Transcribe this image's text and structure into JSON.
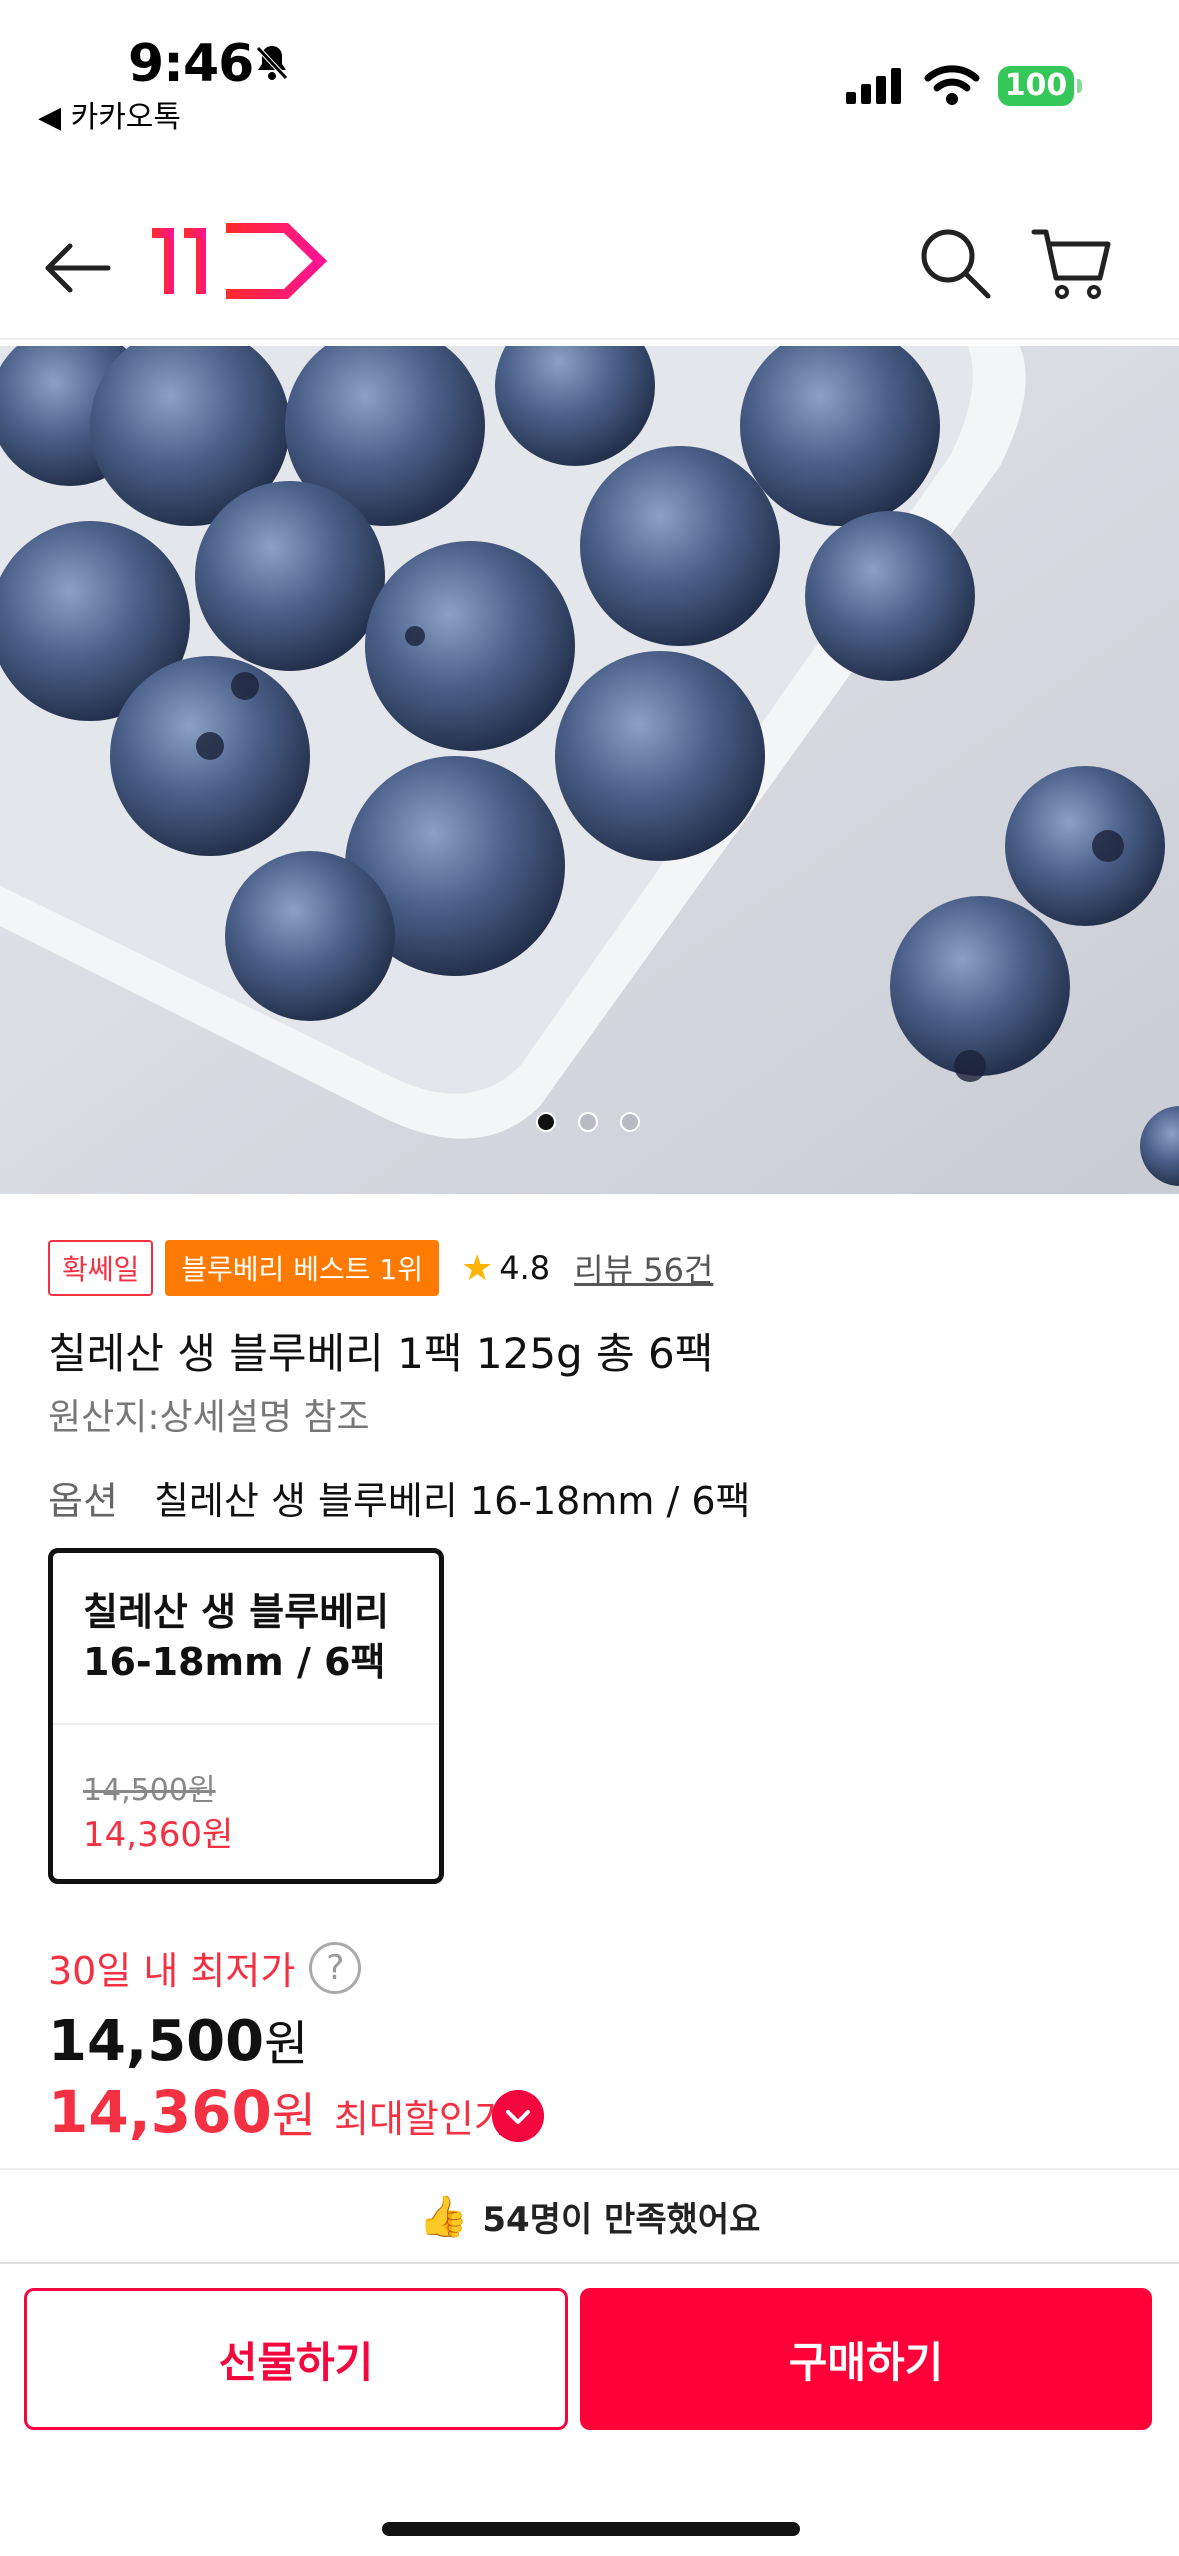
{
  "status": {
    "time": "9:46",
    "back_app": "◀ 카카오톡",
    "battery": "100"
  },
  "header": {
    "logo_text": "11",
    "icons": [
      "back-arrow-icon",
      "search-icon",
      "cart-icon"
    ]
  },
  "gallery": {
    "dot_count": 3,
    "active_index": 0
  },
  "product": {
    "badge_delivery": "확쎄일",
    "badge_best": "블루베리 베스트 1위",
    "rating": "4.8",
    "reviews": "리뷰 56건",
    "title": "칠레산 생 블루베리 1팩 125g 총 6팩",
    "origin": "원산지:상세설명 참조",
    "option_label": "옵션",
    "option_value": "칠레산 생 블루베리 16-18mm / 6팩"
  },
  "option_card": {
    "name": "칠레산 생 블루베리 16-18mm / 6팩",
    "original_price": "14,500원",
    "sale_price": "14,360원"
  },
  "pricing": {
    "lowest_label": "30일 내 최저가",
    "help": "?",
    "price": "14,500",
    "price_unit": "원",
    "sale_price": "14,360",
    "sale_unit": "원",
    "sale_label": "최대할인가"
  },
  "satisfaction": {
    "text": "54명이 만족했어요"
  },
  "actions": {
    "gift": "선물하기",
    "buy": "구매하기"
  },
  "colors": {
    "brand": "#ff0038",
    "sale": "#f43142",
    "badge": "#ff7a00",
    "battery": "#35c759"
  }
}
